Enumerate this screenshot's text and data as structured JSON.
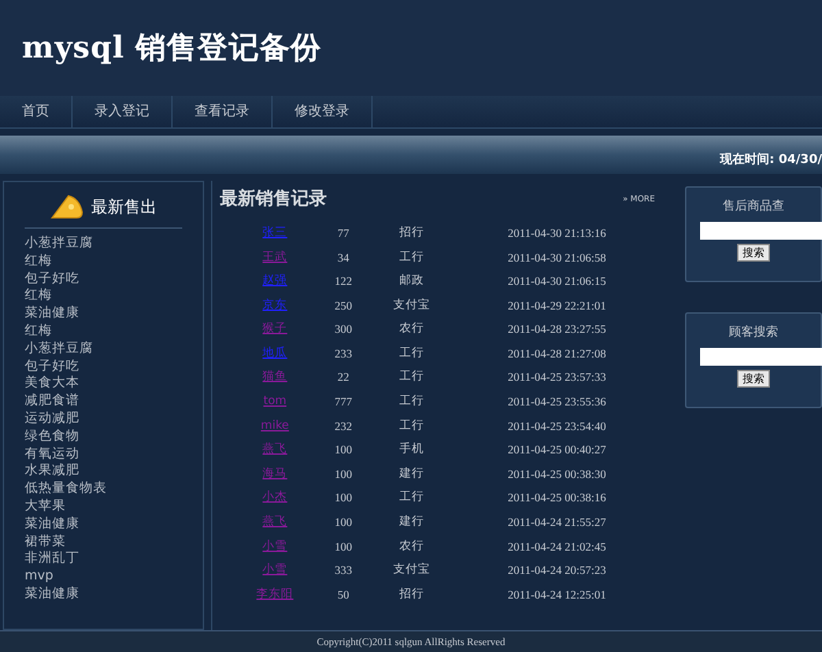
{
  "header": {
    "title": "mysql 销售登记备份"
  },
  "nav": [
    {
      "label": "首页",
      "selected": false
    },
    {
      "label": "录入登记",
      "selected": false
    },
    {
      "label": "查看记录",
      "selected": false
    },
    {
      "label": "修改登录",
      "selected": false
    }
  ],
  "clock": "现在时间: 04/30/",
  "sidebar": {
    "title": "最新售出",
    "items": [
      "小葱拌豆腐",
      "红梅",
      "包子好吃",
      "红梅",
      "菜油健康",
      "红梅",
      "小葱拌豆腐",
      "包子好吃",
      "美食大本",
      "减肥食谱",
      "运动减肥",
      "绿色食物",
      "有氧运动",
      "水果减肥",
      "低热量食物表",
      "大苹果",
      "菜油健康",
      "裙带菜",
      "非洲乱丁",
      "mvp",
      "菜油健康"
    ]
  },
  "records": {
    "title": "最新销售记录",
    "more": "» MORE",
    "rows": [
      {
        "name": "张三",
        "visited": false,
        "amount": "77",
        "bank": "招行",
        "time": "2011-04-30 21:13:16"
      },
      {
        "name": "王武",
        "visited": true,
        "amount": "34",
        "bank": "工行",
        "time": "2011-04-30 21:06:58"
      },
      {
        "name": "赵强",
        "visited": false,
        "amount": "122",
        "bank": "邮政",
        "time": "2011-04-30 21:06:15"
      },
      {
        "name": "京东",
        "visited": false,
        "amount": "250",
        "bank": "支付宝",
        "time": "2011-04-29 22:21:01"
      },
      {
        "name": "猴子",
        "visited": true,
        "amount": "300",
        "bank": "农行",
        "time": "2011-04-28 23:27:55"
      },
      {
        "name": "地瓜",
        "visited": false,
        "amount": "233",
        "bank": "工行",
        "time": "2011-04-28 21:27:08"
      },
      {
        "name": "猫鱼",
        "visited": true,
        "amount": "22",
        "bank": "工行",
        "time": "2011-04-25 23:57:33"
      },
      {
        "name": "tom",
        "visited": true,
        "amount": "777",
        "bank": "工行",
        "time": "2011-04-25 23:55:36"
      },
      {
        "name": "mike",
        "visited": true,
        "amount": "232",
        "bank": "工行",
        "time": "2011-04-25 23:54:40"
      },
      {
        "name": "燕飞",
        "visited": true,
        "amount": "100",
        "bank": "手机",
        "time": "2011-04-25 00:40:27"
      },
      {
        "name": "海马",
        "visited": true,
        "amount": "100",
        "bank": "建行",
        "time": "2011-04-25 00:38:30"
      },
      {
        "name": "小杰",
        "visited": true,
        "amount": "100",
        "bank": "工行",
        "time": "2011-04-25 00:38:16"
      },
      {
        "name": "燕飞",
        "visited": true,
        "amount": "100",
        "bank": "建行",
        "time": "2011-04-24 21:55:27"
      },
      {
        "name": "小雪",
        "visited": true,
        "amount": "100",
        "bank": "农行",
        "time": "2011-04-24 21:02:45"
      },
      {
        "name": "小雪",
        "visited": true,
        "amount": "333",
        "bank": "支付宝",
        "time": "2011-04-24 20:57:23"
      },
      {
        "name": "李东阳",
        "visited": true,
        "amount": "50",
        "bank": "招行",
        "time": "2011-04-24 12:25:01"
      }
    ]
  },
  "search_boxes": [
    {
      "title": "售后商品查",
      "button": "搜索"
    },
    {
      "title": "顾客搜索",
      "button": "搜索"
    }
  ],
  "footer": "Copyright(C)2011 sqlgun AllRights Reserved"
}
